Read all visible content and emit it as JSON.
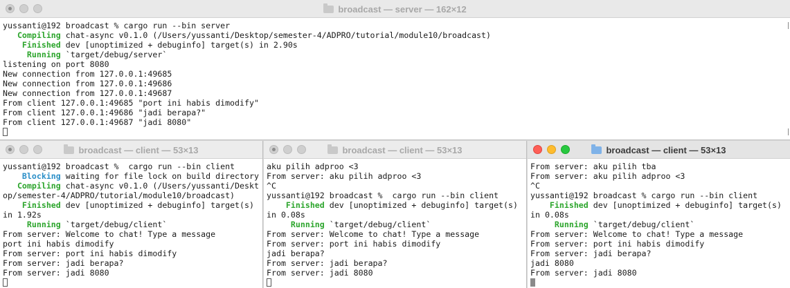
{
  "server": {
    "title": "broadcast — server — 162×12",
    "lines": [
      {
        "text": "yussanti@192 broadcast % cargo run --bin server"
      },
      {
        "kw": "   Compiling",
        "text": " chat-async v0.1.0 (/Users/yussanti/Desktop/semester-4/ADPRO/tutorial/module10/broadcast)"
      },
      {
        "kw": "    Finished",
        "text": " dev [unoptimized + debuginfo] target(s) in 2.90s"
      },
      {
        "kw": "     Running",
        "text": " `target/debug/server`"
      },
      {
        "text": "listening on port 8080"
      },
      {
        "text": "New connection from 127.0.0.1:49685"
      },
      {
        "text": "New connection from 127.0.0.1:49686"
      },
      {
        "text": "New connection from 127.0.0.1:49687"
      },
      {
        "text": "From client 127.0.0.1:49685 \"port ini habis dimodify\""
      },
      {
        "text": "From client 127.0.0.1:49686 \"jadi berapa?\""
      },
      {
        "text": "From client 127.0.0.1:49687 \"jadi 8080\""
      }
    ]
  },
  "client1": {
    "title": "broadcast — client — 53×13",
    "lines": [
      {
        "text": "yussanti@192 broadcast %  cargo run --bin client"
      },
      {
        "kw": "    Blocking",
        "kwclass": "blocking",
        "text": " waiting for file lock on build directory"
      },
      {
        "kw": "   Compiling",
        "text": " chat-async v0.1.0 (/Users/yussanti/Deskt"
      },
      {
        "text": "op/semester-4/ADPRO/tutorial/module10/broadcast)"
      },
      {
        "kw": "    Finished",
        "text": " dev [unoptimized + debuginfo] target(s)"
      },
      {
        "text": "in 1.92s"
      },
      {
        "kw": "     Running",
        "text": " `target/debug/client`"
      },
      {
        "text": "From server: Welcome to chat! Type a message"
      },
      {
        "text": "port ini habis dimodify"
      },
      {
        "text": "From server: port ini habis dimodify"
      },
      {
        "text": "From server: jadi berapa?"
      },
      {
        "text": "From server: jadi 8080"
      }
    ]
  },
  "client2": {
    "title": "broadcast — client — 53×13",
    "lines": [
      {
        "text": "aku pilih adproo <3"
      },
      {
        "text": "From server: aku pilih adproo <3"
      },
      {
        "text": "^C"
      },
      {
        "text": "yussanti@192 broadcast %  cargo run --bin client"
      },
      {
        "kw": "    Finished",
        "text": " dev [unoptimized + debuginfo] target(s)"
      },
      {
        "text": "in 0.08s"
      },
      {
        "kw": "     Running",
        "text": " `target/debug/client`"
      },
      {
        "text": "From server: Welcome to chat! Type a message"
      },
      {
        "text": "From server: port ini habis dimodify"
      },
      {
        "text": "jadi berapa?"
      },
      {
        "text": "From server: jadi berapa?"
      },
      {
        "text": "From server: jadi 8080"
      }
    ]
  },
  "client3": {
    "title": "broadcast — client — 53×13",
    "lines": [
      {
        "text": "From server: aku pilih tba"
      },
      {
        "text": "From server: aku pilih adproo <3"
      },
      {
        "text": "^C"
      },
      {
        "text": "yussanti@192 broadcast % cargo run --bin client"
      },
      {
        "kw": "    Finished",
        "text": " dev [unoptimized + debuginfo] target(s)"
      },
      {
        "text": "in 0.08s"
      },
      {
        "kw": "     Running",
        "text": " `target/debug/client`"
      },
      {
        "text": "From server: Welcome to chat! Type a message"
      },
      {
        "text": "From server: port ini habis dimodify"
      },
      {
        "text": "From server: jadi berapa?"
      },
      {
        "text": "jadi 8080"
      },
      {
        "text": "From server: jadi 8080"
      }
    ]
  }
}
